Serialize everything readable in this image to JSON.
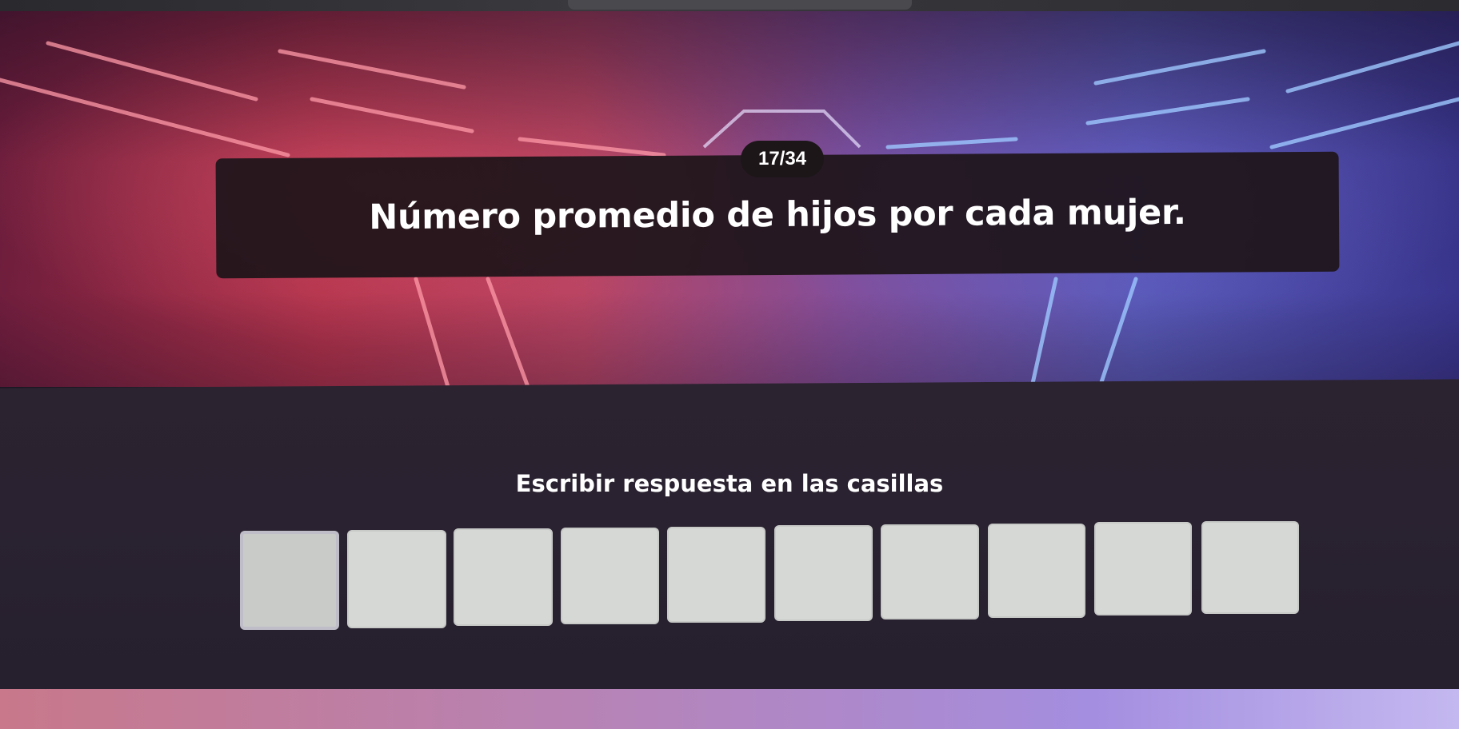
{
  "header": {
    "progress": "17/34"
  },
  "question": {
    "text": "Número promedio de hijos por cada mujer."
  },
  "answer": {
    "instruction": "Escribir respuesta en las casillas",
    "box_count": 10,
    "active_box": 0
  },
  "colors": {
    "panel_dark": "#1e141a",
    "box_fill": "#d6d8d6",
    "art_red": "#c0364f",
    "art_blue": "#5f62c8"
  }
}
